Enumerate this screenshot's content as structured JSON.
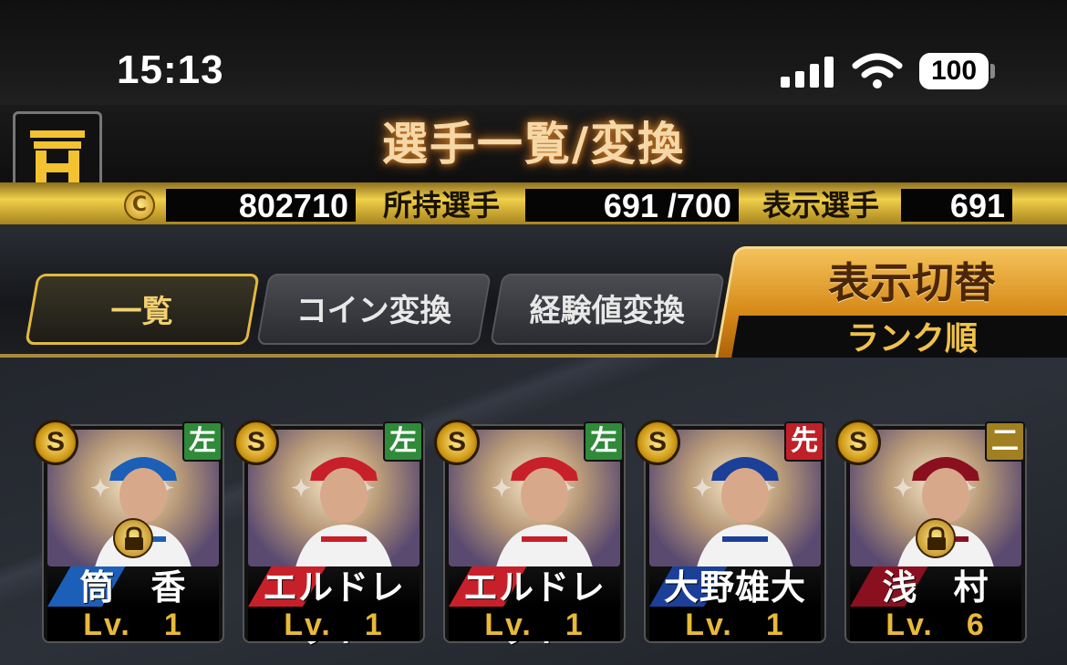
{
  "status_bar": {
    "time": "15:13",
    "battery": "100",
    "signal_icon": "cellular-signal-icon",
    "wifi_icon": "wifi-icon"
  },
  "header": {
    "title": "選手一覧/変換",
    "logo_icon": "team-logo-icon"
  },
  "info_bar": {
    "coin_icon": "coin-icon",
    "coins": "802710",
    "owned_label": "所持選手",
    "owned_value": "691 /700",
    "shown_label": "表示選手",
    "shown_value": "691"
  },
  "tabs": [
    {
      "label": "一覧",
      "active": true
    },
    {
      "label": "コイン変換",
      "active": false
    },
    {
      "label": "経験値変換",
      "active": false
    }
  ],
  "display_toggle": {
    "title": "表示切替",
    "value": "ランク順"
  },
  "cards": [
    {
      "rank": "S",
      "position": "左",
      "position_color": "#2f8a3a",
      "name": "筒　香",
      "level": "Lv.　1",
      "locked": true,
      "team_color": "#1c5fb8"
    },
    {
      "rank": "S",
      "position": "左",
      "position_color": "#2f8a3a",
      "name": "エルドレッド",
      "level": "Lv.　1",
      "locked": false,
      "team_color": "#c8202a"
    },
    {
      "rank": "S",
      "position": "左",
      "position_color": "#2f8a3a",
      "name": "エルドレッド",
      "level": "Lv.　1",
      "locked": false,
      "team_color": "#c8202a"
    },
    {
      "rank": "S",
      "position": "先",
      "position_color": "#c02028",
      "name": "大野雄大",
      "level": "Lv.　1",
      "locked": false,
      "team_color": "#1c3f98"
    },
    {
      "rank": "S",
      "position": "二",
      "position_color": "#a08020",
      "name": "浅　村",
      "level": "Lv.　6",
      "locked": true,
      "team_color": "#8a1020"
    }
  ]
}
